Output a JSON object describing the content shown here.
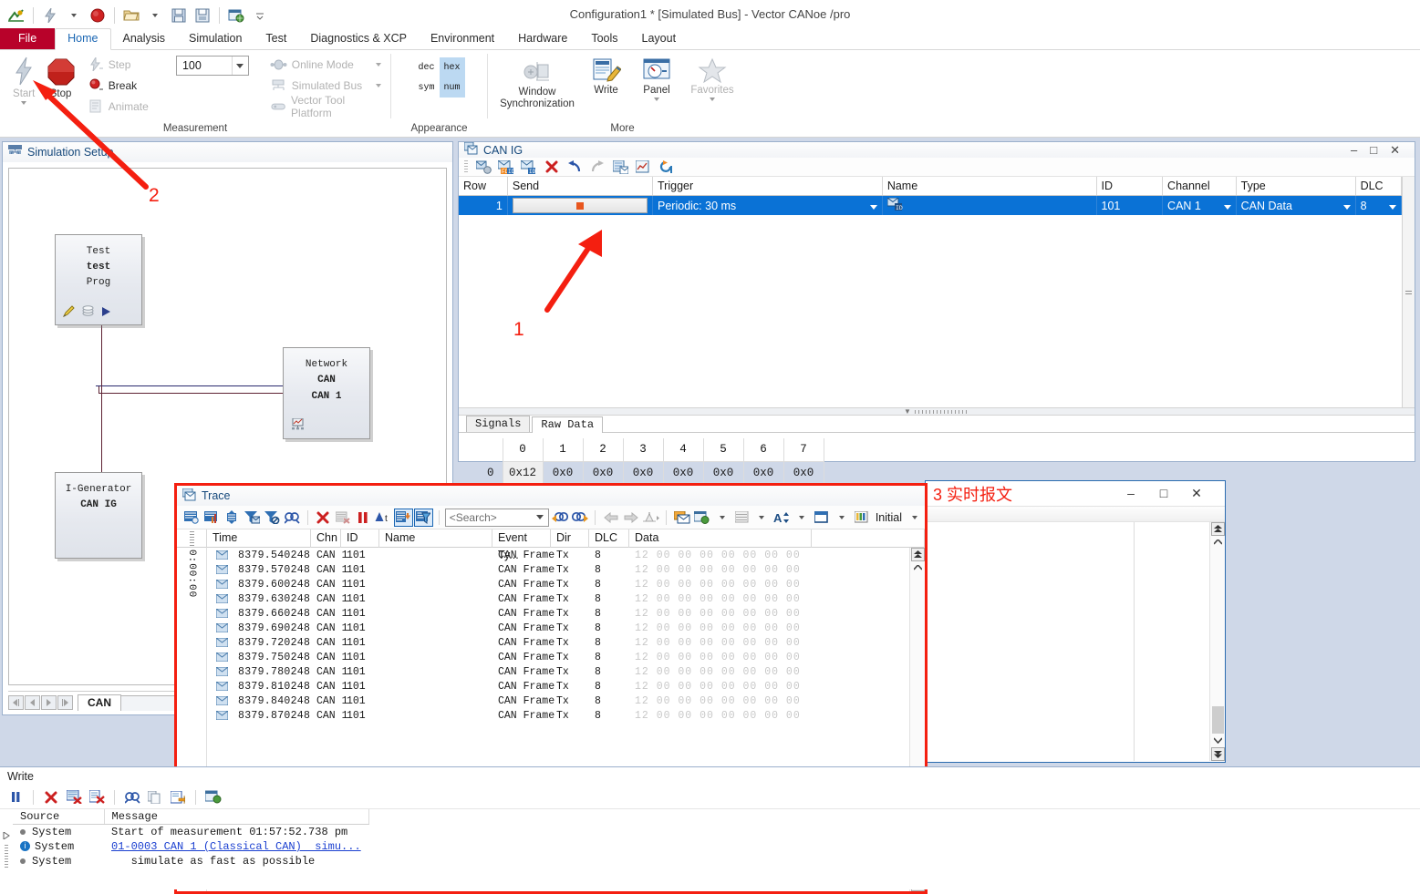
{
  "app": {
    "title": "Configuration1 * [Simulated Bus] - Vector CANoe /pro"
  },
  "quick_access": {
    "icons": [
      "canoe-logo-icon",
      "measurement-start-icon",
      "dropdown-caret-icon",
      "stop-icon",
      "open-folder-icon",
      "dropdown-caret-icon",
      "save-icon",
      "save-as-icon",
      "options-icon",
      "customize-caret-icon"
    ]
  },
  "ribbon": {
    "tabs": [
      {
        "label": "File",
        "active": false,
        "kind": "file"
      },
      {
        "label": "Home",
        "active": true
      },
      {
        "label": "Analysis",
        "active": false
      },
      {
        "label": "Simulation",
        "active": false
      },
      {
        "label": "Test",
        "active": false
      },
      {
        "label": "Diagnostics & XCP",
        "active": false
      },
      {
        "label": "Environment",
        "active": false
      },
      {
        "label": "Hardware",
        "active": false
      },
      {
        "label": "Tools",
        "active": false
      },
      {
        "label": "Layout",
        "active": false
      }
    ],
    "groups": [
      {
        "label": "Measurement",
        "big_buttons": [
          {
            "label": "Start",
            "icon": "lightning-start-icon",
            "enabled": false,
            "split": true
          },
          {
            "label": "Stop",
            "icon": "stop-octagon-icon",
            "enabled": true,
            "split": false
          }
        ],
        "small_buttons": [
          {
            "label": "Step",
            "icon": "step-icon",
            "enabled": false
          },
          {
            "label": "Break",
            "icon": "break-icon",
            "enabled": true
          },
          {
            "label": "Animate",
            "icon": "animate-icon",
            "enabled": false
          }
        ],
        "speed_value": "100",
        "mode_buttons": [
          {
            "label": "Online Mode",
            "icon": "online-mode-icon",
            "enabled": false
          },
          {
            "label": "Simulated Bus",
            "icon": "simulated-bus-icon",
            "enabled": false
          },
          {
            "label": "Vector Tool Platform",
            "icon": "vector-tool-platform-icon",
            "enabled": false
          }
        ]
      },
      {
        "label": "Appearance",
        "toggles": [
          {
            "label": "dec",
            "on": false
          },
          {
            "label": "hex",
            "on": true
          },
          {
            "label": "sym",
            "on": false
          },
          {
            "label": "num",
            "on": true
          }
        ]
      },
      {
        "label": "More",
        "big_buttons": [
          {
            "label": "Window\nSynchronization",
            "icon": "window-sync-icon",
            "enabled": false,
            "split": false
          },
          {
            "label": "Write",
            "icon": "write-window-icon",
            "enabled": true,
            "split": false
          },
          {
            "label": "Panel",
            "icon": "panel-icon",
            "enabled": true,
            "split": true
          },
          {
            "label": "Favorites",
            "icon": "favorites-star-icon",
            "enabled": false,
            "split": true
          }
        ]
      }
    ]
  },
  "simulation_setup": {
    "title": "Simulation Setup",
    "nodes": [
      {
        "id": "test",
        "l1": "Test",
        "l2": "test",
        "l3": "Prog",
        "icons": [
          "edit-pencil-icon",
          "compile-icon",
          "run-play-icon"
        ]
      },
      {
        "id": "network",
        "l1": "Network",
        "l2": "CAN",
        "l3": "CAN 1",
        "icons": [
          "bus-statistics-icon"
        ]
      },
      {
        "id": "igenerator",
        "l1": "I-Generator",
        "l2": "CAN IG",
        "l3": "",
        "icons": []
      }
    ],
    "sheet_tab": "CAN",
    "nav_buttons": [
      "first-sheet-button",
      "prev-sheet-button",
      "next-sheet-button",
      "last-sheet-button"
    ]
  },
  "can_ig": {
    "title": "CAN IG",
    "window_buttons": [
      "minimize-button",
      "maximize-button",
      "close-button"
    ],
    "toolbar_icons": [
      "new-message-icon",
      "new-canfd-message-icon",
      "new-can-message-icon",
      "delete-icon",
      "undo-icon",
      "redo-icon",
      "save-list-icon",
      "load-list-icon",
      "refresh-icon"
    ],
    "columns": [
      "Row",
      "Send",
      "Trigger",
      "Name",
      "ID",
      "Channel",
      "Type",
      "DLC"
    ],
    "rows": [
      {
        "row": "1",
        "send": "stop-toggle-button",
        "trigger": "Periodic: 30 ms",
        "name": "can-message-icon",
        "id": "101",
        "channel": "CAN 1",
        "type": "CAN Data",
        "dlc": "8",
        "selected": true
      }
    ],
    "tabs": [
      {
        "label": "Signals",
        "active": false
      },
      {
        "label": "Raw Data",
        "active": true
      }
    ],
    "raw_data": {
      "byte_headers": [
        "0",
        "1",
        "2",
        "3",
        "4",
        "5",
        "6",
        "7"
      ],
      "row_label": "0",
      "values": [
        "0x12",
        "0x0",
        "0x0",
        "0x0",
        "0x0",
        "0x0",
        "0x0",
        "0x0"
      ]
    }
  },
  "trace": {
    "title": "Trace",
    "toolbar_icons": [
      "trace-config-icon",
      "statistics-icon",
      "expand-all-icon",
      "filter-messages-icon",
      "stop-filter-icon",
      "find-icon",
      "clear-icon",
      "clear-selected-icon",
      "pause-icon",
      "relative-time-icon",
      "scroll-lock-icon",
      "filter-active-icon",
      "search-prev-icon",
      "search-next-icon",
      "back-icon",
      "forward-icon",
      "marker-icon",
      "copy-to-icon",
      "export-icon",
      "layout-icon",
      "font-icon",
      "columns-icon",
      "colors-icon"
    ],
    "search_placeholder": "<Search>",
    "layout_label": "Initial",
    "columns": [
      "Time",
      "Chn",
      "ID",
      "Name",
      "Event Ty...",
      "Dir",
      "DLC",
      "Data"
    ],
    "time_gutter": "0:00:00",
    "rows": [
      {
        "icon": "can-frame-icon",
        "time": "8379.540248",
        "chn": "CAN 1",
        "id": "101",
        "name": "",
        "event": "CAN Frame",
        "dir": "Tx",
        "dlc": "8",
        "data": "12 00 00 00 00 00 00 00"
      },
      {
        "icon": "can-frame-icon",
        "time": "8379.570248",
        "chn": "CAN 1",
        "id": "101",
        "name": "",
        "event": "CAN Frame",
        "dir": "Tx",
        "dlc": "8",
        "data": "12 00 00 00 00 00 00 00"
      },
      {
        "icon": "can-frame-icon",
        "time": "8379.600248",
        "chn": "CAN 1",
        "id": "101",
        "name": "",
        "event": "CAN Frame",
        "dir": "Tx",
        "dlc": "8",
        "data": "12 00 00 00 00 00 00 00"
      },
      {
        "icon": "can-frame-icon",
        "time": "8379.630248",
        "chn": "CAN 1",
        "id": "101",
        "name": "",
        "event": "CAN Frame",
        "dir": "Tx",
        "dlc": "8",
        "data": "12 00 00 00 00 00 00 00"
      },
      {
        "icon": "can-frame-icon",
        "time": "8379.660248",
        "chn": "CAN 1",
        "id": "101",
        "name": "",
        "event": "CAN Frame",
        "dir": "Tx",
        "dlc": "8",
        "data": "12 00 00 00 00 00 00 00"
      },
      {
        "icon": "can-frame-icon",
        "time": "8379.690248",
        "chn": "CAN 1",
        "id": "101",
        "name": "",
        "event": "CAN Frame",
        "dir": "Tx",
        "dlc": "8",
        "data": "12 00 00 00 00 00 00 00"
      },
      {
        "icon": "can-frame-icon",
        "time": "8379.720248",
        "chn": "CAN 1",
        "id": "101",
        "name": "",
        "event": "CAN Frame",
        "dir": "Tx",
        "dlc": "8",
        "data": "12 00 00 00 00 00 00 00"
      },
      {
        "icon": "can-frame-icon",
        "time": "8379.750248",
        "chn": "CAN 1",
        "id": "101",
        "name": "",
        "event": "CAN Frame",
        "dir": "Tx",
        "dlc": "8",
        "data": "12 00 00 00 00 00 00 00"
      },
      {
        "icon": "can-frame-icon",
        "time": "8379.780248",
        "chn": "CAN 1",
        "id": "101",
        "name": "",
        "event": "CAN Frame",
        "dir": "Tx",
        "dlc": "8",
        "data": "12 00 00 00 00 00 00 00"
      },
      {
        "icon": "can-frame-icon",
        "time": "8379.810248",
        "chn": "CAN 1",
        "id": "101",
        "name": "",
        "event": "CAN Frame",
        "dir": "Tx",
        "dlc": "8",
        "data": "12 00 00 00 00 00 00 00"
      },
      {
        "icon": "can-frame-icon",
        "time": "8379.840248",
        "chn": "CAN 1",
        "id": "101",
        "name": "",
        "event": "CAN Frame",
        "dir": "Tx",
        "dlc": "8",
        "data": "12 00 00 00 00 00 00 00"
      },
      {
        "icon": "can-frame-icon",
        "time": "8379.870248",
        "chn": "CAN 1",
        "id": "101",
        "name": "",
        "event": "CAN Frame",
        "dir": "Tx",
        "dlc": "8",
        "data": "12 00 00 00 00 00 00 00"
      }
    ]
  },
  "background_window": {
    "annotation": "3 实时报文",
    "window_buttons": [
      "minimize-button",
      "maximize-button",
      "close-button"
    ]
  },
  "write": {
    "title": "Write",
    "toolbar_icons": [
      "pause-icon",
      "clear-icon",
      "clear-all-icon",
      "clear-page-icon",
      "find-icon",
      "copy-icon",
      "export-icon",
      "open-in-browser-icon"
    ],
    "columns": [
      "Source",
      "Message"
    ],
    "rows": [
      {
        "marker": "dot",
        "source": "System",
        "message": "Start of measurement 01:57:52.738 pm",
        "link": false
      },
      {
        "marker": "info",
        "source": "System",
        "message": "01-0003 CAN 1 (Classical CAN)  simu...",
        "link": true
      },
      {
        "marker": "dot",
        "source": "System",
        "message": "   simulate as fast as possible",
        "link": false
      }
    ]
  },
  "annotations": {
    "n1": "1",
    "n2": "2",
    "color": "#f41f10"
  }
}
